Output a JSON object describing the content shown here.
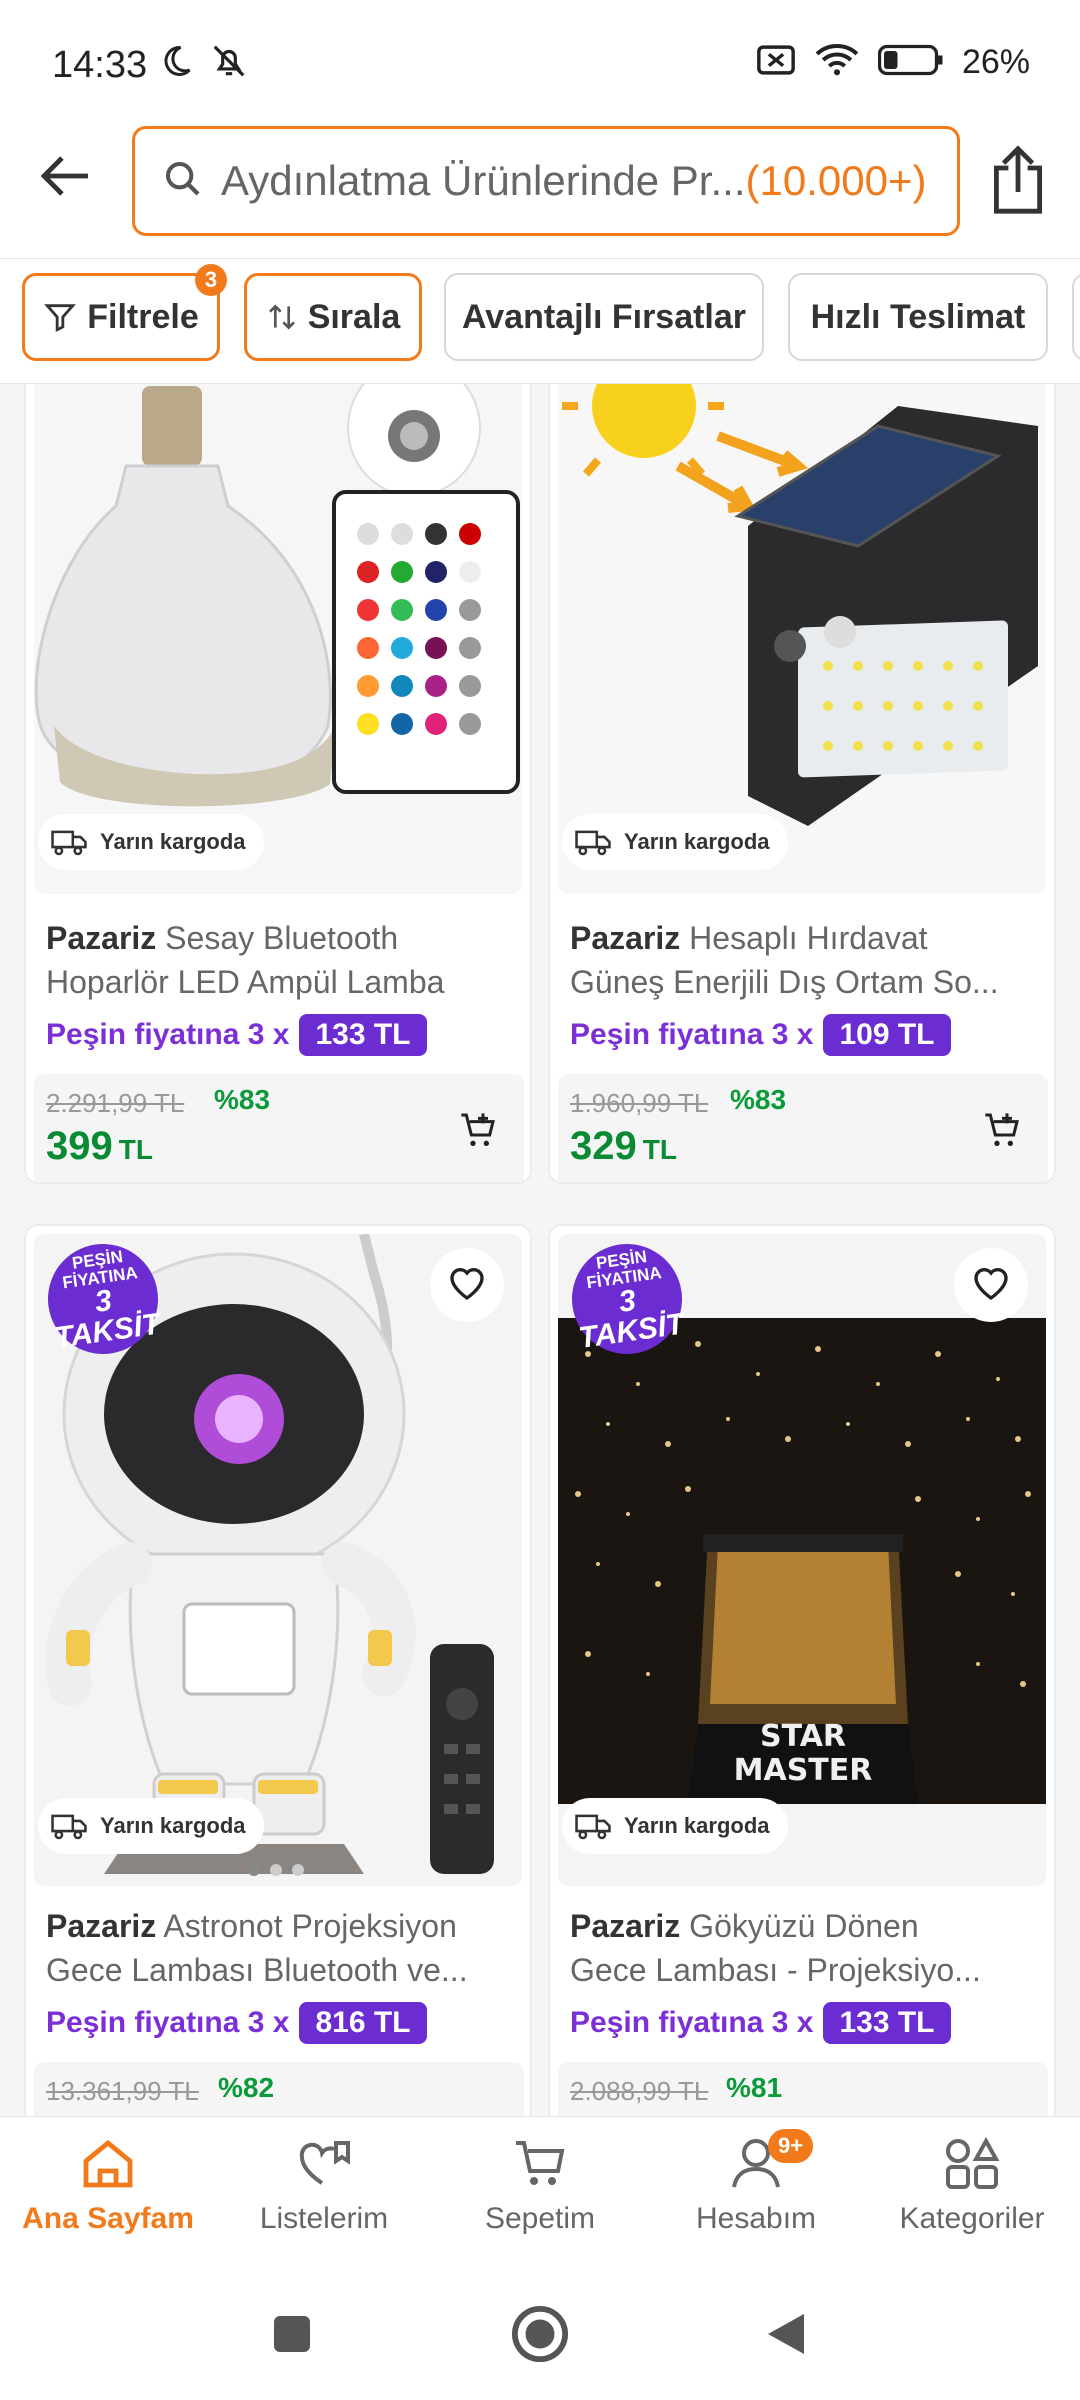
{
  "status": {
    "time": "14:33",
    "battery": "26%"
  },
  "search": {
    "placeholder": "Aydınlatma Ürünlerinde Pr...",
    "count": "(10.000+)"
  },
  "filters": {
    "filter_label": "Filtrele",
    "filter_badge": "3",
    "sort_label": "Sırala",
    "chips": [
      "Avantajlı Fırsatlar",
      "Hızlı Teslimat"
    ]
  },
  "products": [
    {
      "brand": "Pazariz",
      "name_line1": "Sesay Bluetooth",
      "name_line2": "Hoparlör LED Ampül Lamba",
      "cargo": "Yarın kargoda",
      "installment_text": "Peşin fiyatına 3 x",
      "installment_amount": "133 TL",
      "old_price": "2.291,99 TL",
      "discount": "%83",
      "price": "399",
      "currency": "TL"
    },
    {
      "brand": "Pazariz",
      "name_line1": "Hesaplı Hırdavat",
      "name_line2": "Güneş Enerjili Dış Ortam So...",
      "cargo": "Yarın kargoda",
      "installment_text": "Peşin fiyatına 3 x",
      "installment_amount": "109 TL",
      "old_price": "1.960,99 TL",
      "discount": "%83",
      "price": "329",
      "currency": "TL"
    },
    {
      "brand": "Pazariz",
      "name_line1": "Astronot Projeksiyon",
      "name_line2": "Gece Lambası Bluetooth ve...",
      "cargo": "Yarın kargoda",
      "promo_l1": "PEŞİN FİYATINA",
      "promo_l2": "3 TAKSİT",
      "installment_text": "Peşin fiyatına 3 x",
      "installment_amount": "816 TL",
      "old_price": "13.361,99 TL",
      "discount": "%82"
    },
    {
      "brand": "Pazariz",
      "name_line1": "Gökyüzü Dönen",
      "name_line2": "Gece Lambası - Projeksiyo...",
      "cargo": "Yarın kargoda",
      "promo_l1": "PEŞİN FİYATINA",
      "promo_l2": "3 TAKSİT",
      "image_text_1": "STAR",
      "image_text_2": "MASTER",
      "installment_text": "Peşin fiyatına 3 x",
      "installment_amount": "133 TL",
      "old_price": "2.088,99 TL",
      "discount": "%81"
    }
  ],
  "bottom_nav": {
    "items": [
      {
        "label": "Ana Sayfam",
        "icon": "home-icon"
      },
      {
        "label": "Listelerim",
        "icon": "list-heart-icon"
      },
      {
        "label": "Sepetim",
        "icon": "cart-icon"
      },
      {
        "label": "Hesabım",
        "icon": "user-icon"
      },
      {
        "label": "Kategoriler",
        "icon": "categories-icon"
      }
    ],
    "account_badge": "9+"
  },
  "colors": {
    "accent": "#f27a1a",
    "purple": "#6b2dd1",
    "price_green": "#0a8a32"
  }
}
